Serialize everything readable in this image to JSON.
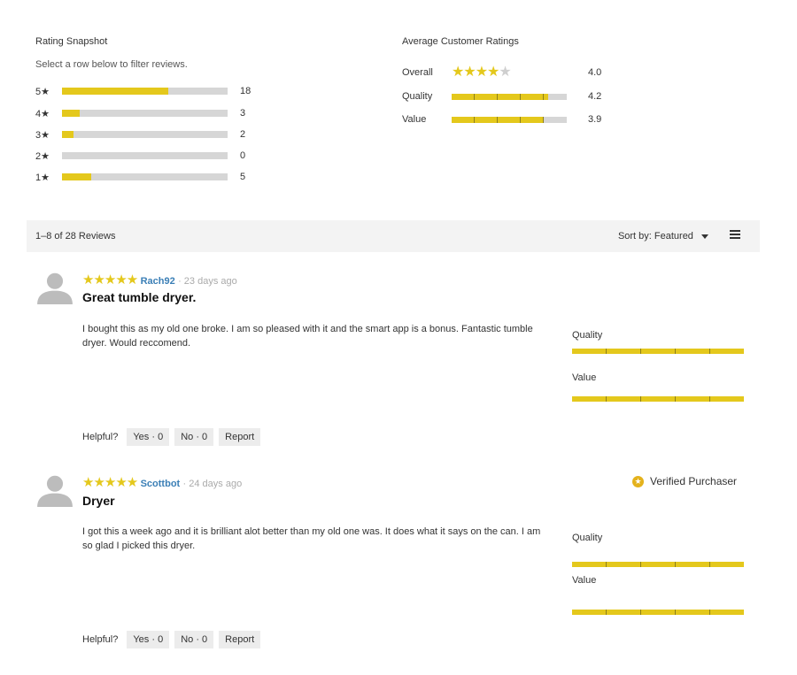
{
  "snapshot": {
    "title": "Rating Snapshot",
    "subtitle": "Select a row below to filter reviews.",
    "rows": [
      {
        "label": "5★",
        "count": "18",
        "fraction": 0.643
      },
      {
        "label": "4★",
        "count": "3",
        "fraction": 0.107
      },
      {
        "label": "3★",
        "count": "2",
        "fraction": 0.071
      },
      {
        "label": "2★",
        "count": "0",
        "fraction": 0
      },
      {
        "label": "1★",
        "count": "5",
        "fraction": 0.179
      }
    ]
  },
  "average": {
    "title": "Average Customer Ratings",
    "overall": {
      "label": "Overall",
      "value": "4.0",
      "stars": 4
    },
    "quality": {
      "label": "Quality",
      "value": "4.2",
      "fraction": 0.84
    },
    "value": {
      "label": "Value",
      "value": "3.9",
      "fraction": 0.79
    }
  },
  "toolbar": {
    "count_text": "1–8 of 28 Reviews",
    "sort_text": "Sort by: Featured",
    "menu_icon": "menu-icon"
  },
  "reviews": [
    {
      "stars": "★★★★★",
      "author": "Rach92",
      "age": "· 23 days ago",
      "title": "Great tumble dryer.",
      "body": "I bought this as my old one broke. I am so pleased with it and the smart app is a bonus. Fantastic tumble dryer. Would reccomend.",
      "quality_label": "Quality",
      "quality_fraction": 1.0,
      "value_label": "Value",
      "value_fraction": 1.0,
      "helpful_label": "Helpful?",
      "yes_label": "Yes · 0",
      "no_label": "No · 0",
      "report_label": "Report",
      "verified": ""
    },
    {
      "stars": "★★★★★",
      "author": "Scottbot",
      "age": "· 24 days ago",
      "title": "Dryer",
      "body": "I got this a week ago and it is brilliant alot better than my old one was. It does what it says on the can. I am so glad I picked this dryer.",
      "quality_label": "Quality",
      "quality_fraction": 1.0,
      "value_label": "Value",
      "value_fraction": 1.0,
      "helpful_label": "Helpful?",
      "yes_label": "Yes · 0",
      "no_label": "No · 0",
      "report_label": "Report",
      "verified": "Verified Purchaser"
    }
  ],
  "colors": {
    "accent": "#e4c81c",
    "bar_bg": "#d6d6d6",
    "link": "#3b7fb6",
    "toolbar_bg": "#f3f3f3"
  }
}
